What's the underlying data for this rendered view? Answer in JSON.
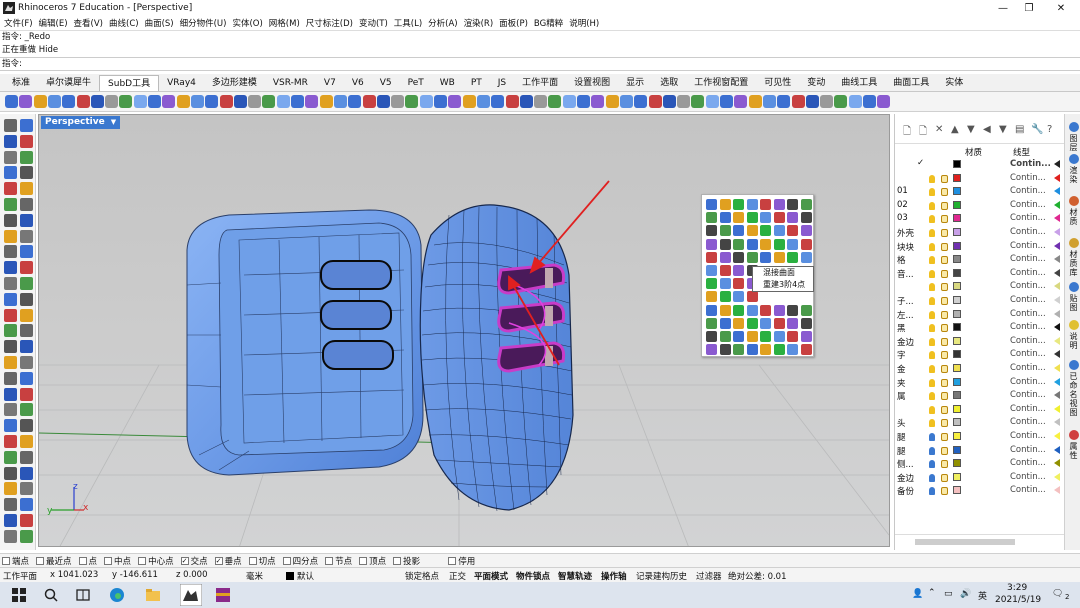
{
  "window": {
    "title": "Rhinoceros 7 Education - [Perspective]",
    "controls": [
      "—",
      "❐",
      "✕"
    ]
  },
  "menu": [
    "文件(F)",
    "编辑(E)",
    "查看(V)",
    "曲线(C)",
    "曲面(S)",
    "细分物件(U)",
    "实体(O)",
    "网格(M)",
    "尺寸标注(D)",
    "变动(T)",
    "工具(L)",
    "分析(A)",
    "渲染(R)",
    "面板(P)",
    "BG精粹",
    "说明(H)"
  ],
  "command_history": [
    "指令: _Redo",
    "正在重做 Hide"
  ],
  "command_prompt": "指令:",
  "tabs": {
    "active_index": 2,
    "items": [
      "标准",
      "卓尔谟犀牛",
      "SubD工具",
      "VRay4",
      "多边形建模",
      "VSR-MR",
      "V7",
      "V6",
      "V5",
      "PeT",
      "WB",
      "PT",
      "JS",
      "工作平面",
      "设置视图",
      "显示",
      "选取",
      "工作视窗配置",
      "可见性",
      "变动",
      "曲线工具",
      "曲面工具",
      "实体"
    ]
  },
  "viewport": {
    "label": "Perspective",
    "axes": {
      "x": "x",
      "y": "y",
      "z": "z"
    }
  },
  "tooltip": {
    "line1": "混接曲面",
    "line2": "重建3阶4点"
  },
  "layers_panel": {
    "col_material": "材质",
    "col_linetype": "线型",
    "default_check": "✓",
    "rows": [
      {
        "name": "",
        "color": "#000000",
        "linetype": "Contin...",
        "bold": true,
        "current": true
      },
      {
        "name": "",
        "color": "#e0201e",
        "linetype": "Contin..."
      },
      {
        "name": "01",
        "color": "#1e8fe0",
        "linetype": "Contin..."
      },
      {
        "name": "02",
        "color": "#20b030",
        "linetype": "Contin..."
      },
      {
        "name": "03",
        "color": "#e02890",
        "linetype": "Contin..."
      },
      {
        "name": "外壳",
        "color": "#c8a0e8",
        "linetype": "Contin..."
      },
      {
        "name": "块块",
        "color": "#7030b0",
        "linetype": "Contin..."
      },
      {
        "name": "格",
        "color": "#888888",
        "linetype": "Contin..."
      },
      {
        "name": "音...",
        "color": "#444444",
        "linetype": "Contin..."
      },
      {
        "name": "",
        "color": "#d8d880",
        "linetype": "Contin..."
      },
      {
        "name": "子...",
        "color": "#d0d0d0",
        "linetype": "Contin..."
      },
      {
        "name": "左...",
        "color": "#b0b0b0",
        "linetype": "Contin..."
      },
      {
        "name": "黑",
        "color": "#111111",
        "linetype": "Contin..."
      },
      {
        "name": "金边",
        "color": "#e8e880",
        "linetype": "Contin..."
      },
      {
        "name": "字",
        "color": "#333333",
        "linetype": "Contin..."
      },
      {
        "name": "金",
        "color": "#f0e050",
        "linetype": "Contin..."
      },
      {
        "name": "夹",
        "color": "#20a0e0",
        "linetype": "Contin..."
      },
      {
        "name": "属",
        "color": "#777777",
        "linetype": "Contin..."
      },
      {
        "name": "",
        "color": "#f0f030",
        "linetype": "Contin..."
      },
      {
        "name": "头",
        "color": "#c0c0c0",
        "linetype": "Contin..."
      },
      {
        "name": "腿",
        "color": "#f8f040",
        "linetype": "Contin..."
      },
      {
        "name": "腿",
        "color": "#2060c0",
        "linetype": "Contin..."
      },
      {
        "name": "侧...",
        "color": "#909000",
        "linetype": "Contin..."
      },
      {
        "name": "金边",
        "color": "#f0f060",
        "linetype": "Contin..."
      },
      {
        "name": "备份",
        "color": "#f4c0c0",
        "linetype": "Contin..."
      }
    ]
  },
  "side_tabs": [
    "图层",
    "渲染",
    "材质",
    "材质库",
    "贴图",
    "说明",
    "已命名视图",
    "属性"
  ],
  "osnap": [
    {
      "label": "端点",
      "checked": false
    },
    {
      "label": "最近点",
      "checked": false
    },
    {
      "label": "点",
      "checked": false
    },
    {
      "label": "中点",
      "checked": false
    },
    {
      "label": "中心点",
      "checked": false
    },
    {
      "label": "交点",
      "checked": true
    },
    {
      "label": "垂点",
      "checked": true
    },
    {
      "label": "切点",
      "checked": false
    },
    {
      "label": "四分点",
      "checked": false
    },
    {
      "label": "节点",
      "checked": false
    },
    {
      "label": "顶点",
      "checked": false
    },
    {
      "label": "投影",
      "checked": false
    },
    {
      "label": "停用",
      "checked": false
    }
  ],
  "status": {
    "cplane": "工作平面",
    "x": "x 1041.023",
    "y": "y -146.611",
    "z": "z 0.000",
    "units": "毫米",
    "layer": "默认",
    "modes": [
      "锁定格点",
      "正交",
      "平面模式",
      "物件锁点",
      "智慧轨迹",
      "操作轴",
      "记录建构历史",
      "过滤器"
    ],
    "tolerance": "绝对公差: 0.01"
  },
  "taskbar": {
    "time": "3:29",
    "date": "2021/5/19",
    "ime": "英",
    "notif_count": "2"
  }
}
